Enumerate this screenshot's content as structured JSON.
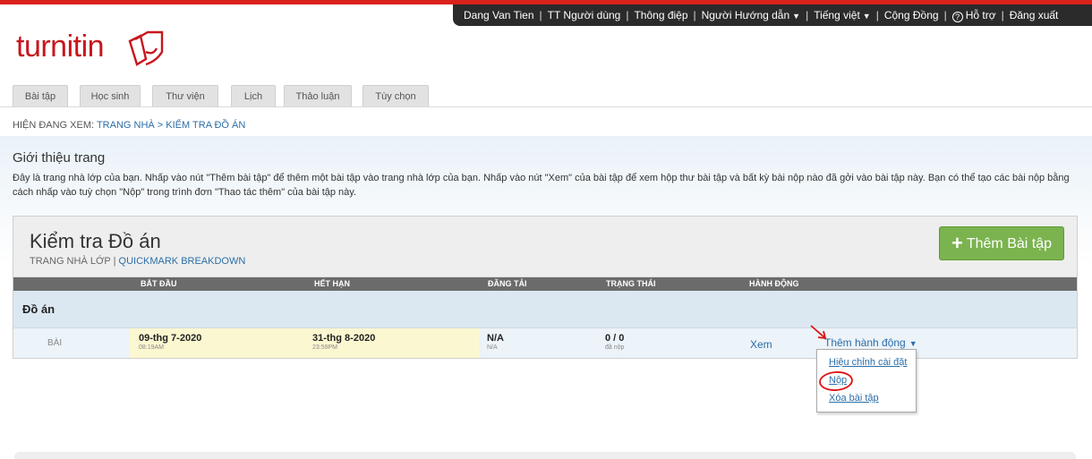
{
  "top_nav": {
    "user": "Dang Van Tien",
    "user_info": "TT Người dùng",
    "messages": "Thông điệp",
    "role": "Người Hướng dẫn",
    "language": "Tiếng việt",
    "community": "Cộng Đồng",
    "help_glyph": "?",
    "help": "Hỗ trợ",
    "logout": "Đăng xuất",
    "separator": "|"
  },
  "logo": {
    "text": "turnitin",
    "brand_color": "#c8161d"
  },
  "tabs": [
    "Bài tập",
    "Học sinh",
    "Thư viện",
    "Lịch",
    "Thảo luận",
    "Tùy chọn"
  ],
  "breadcrumb": {
    "prefix": "HIỆN ĐANG XEM:",
    "home": "TRANG NHÀ",
    "separator": ">",
    "current": "KIỂM TRA ĐỒ ÁN"
  },
  "intro": {
    "title": "Giới thiệu trang",
    "text": "Đây là trang nhà lớp của bạn. Nhấp vào nút \"Thêm bài tập\" để thêm một bài tập vào trang nhà lớp của bạn. Nhấp vào nút \"Xem\" của bài tập để xem hộp thư bài tập và bất kỳ bài nộp nào đã gởi vào bài tập này. Bạn có thể tạo các bài nộp bằng cách nhấp vào tuỳ chọn \"Nộp\" trong trình đơn \"Thao tác thêm\" của bài tập này."
  },
  "course": {
    "title": "Kiểm tra Đồ án",
    "sub_home": "TRANG NHÀ LỚP",
    "sub_sep": "|",
    "sub_link": "QUICKMARK BREAKDOWN",
    "add_button": "Thêm Bài tập",
    "accent": "#7bb34f"
  },
  "columns": [
    "BẮT ĐẦU",
    "HẾT HẠN",
    "ĐĂNG TẢI",
    "TRẠNG THÁI",
    "HÀNH ĐỘNG"
  ],
  "section": {
    "name": "Đồ án"
  },
  "assignment": {
    "type": "BÀI",
    "start_date": "09-thg 7-2020",
    "start_time": "08:19AM",
    "due_date": "31-thg 8-2020",
    "due_time": "23:59PM",
    "post": "N/A",
    "post_sub": "N/A",
    "status": "0 / 0",
    "status_sub": "đã nộp",
    "view": "Xem",
    "more_actions": "Thêm hành động"
  },
  "dropdown": [
    "Hiệu chỉnh cài đặt",
    "Nộp",
    "Xóa bài tập"
  ],
  "annotation_color": "#e01010"
}
